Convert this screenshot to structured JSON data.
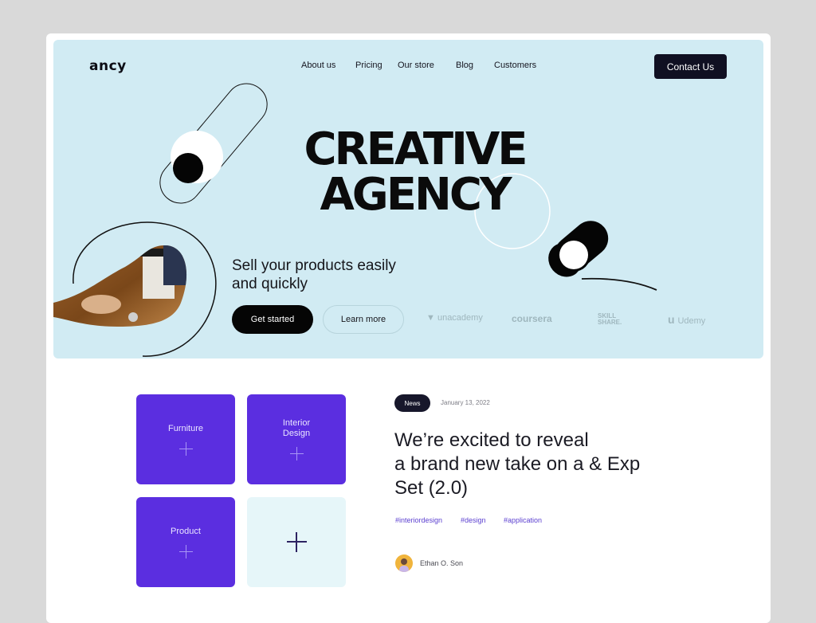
{
  "brand": {
    "logo": "ancy"
  },
  "nav": {
    "items": [
      "About us",
      "Pricing",
      "Our store",
      "Blog",
      "Customers"
    ],
    "contact_label": "Contact Us"
  },
  "hero": {
    "title_line1": "CREATIVE",
    "title_line2": "AGENCY",
    "tagline_line1": "Sell your products easily",
    "tagline_line2": "and quickly",
    "primary_button": "Get started",
    "secondary_button": "Learn more",
    "partners": [
      "unacademy",
      "coursera",
      "SKILL",
      "SHARE.",
      "Udemy"
    ]
  },
  "categories": {
    "tiles": [
      "Furniture",
      "Interior",
      "Design",
      "Product"
    ]
  },
  "article": {
    "badge": "News",
    "date": "January 13, 2022",
    "headline_line1": "We’re excited to reveal",
    "headline_line2": "a brand new take on a & Exp",
    "headline_line3": "Set (2.0)",
    "tags": [
      "#interiordesign",
      "#design",
      "#application"
    ],
    "author": "Ethan O. Son"
  },
  "colors": {
    "page_bg": "#d9d9d9",
    "hero_bg": "#d1ebf3",
    "accent_purple": "#5b2ee0",
    "dark_button": "#101022",
    "tile_light": "#e6f6f9"
  },
  "icons": [
    "plus-icon",
    "user-avatar-icon"
  ]
}
